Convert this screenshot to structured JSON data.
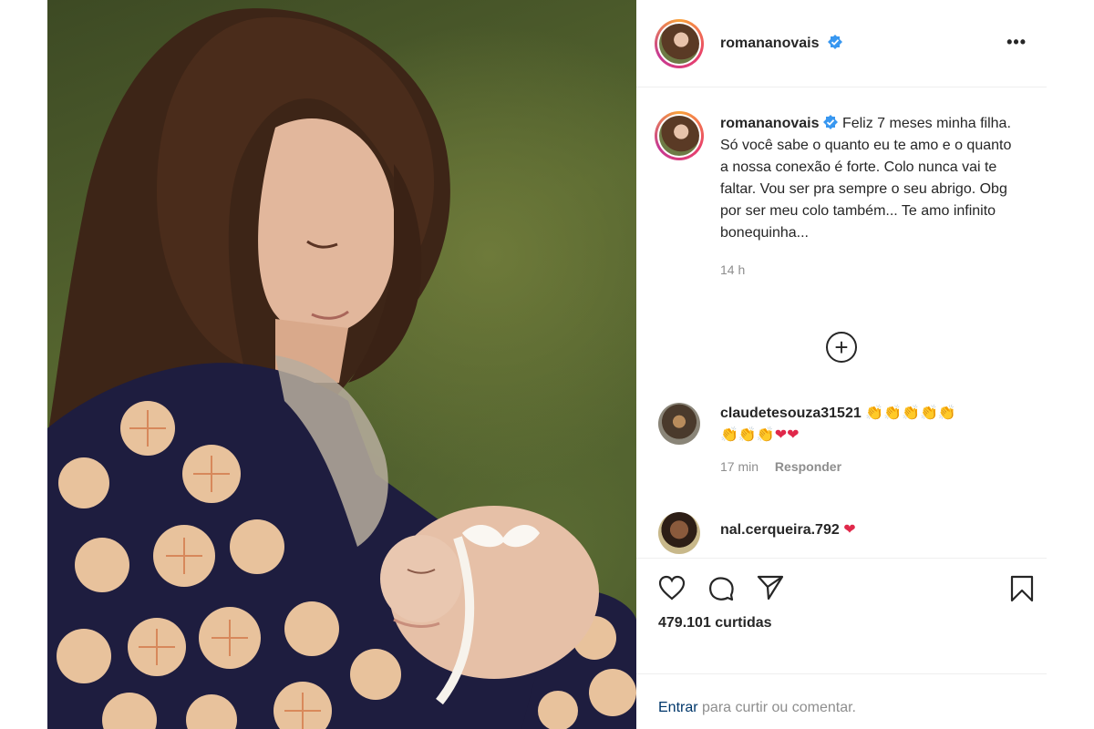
{
  "post": {
    "username": "romananovais",
    "more_icon": "more-dots-icon",
    "verified_icon": "verified-badge-icon"
  },
  "caption": {
    "username": "romananovais",
    "text": "Feliz 7 meses minha filha. Só você sabe o quanto eu te amo e o quanto a nossa conexão é forte. Colo nunca vai te faltar. Vou ser pra sempre o seu abrigo. Obg por ser meu colo também... Te amo infinito bonequinha...",
    "time": "14 h"
  },
  "load_more_label": "+",
  "comments": [
    {
      "username": "claudetesouza31521",
      "text_emoji": "👏👏👏👏👏",
      "text_emoji2": "👏👏👏",
      "hearts": "❤❤",
      "time": "17 min",
      "reply_label": "Responder"
    },
    {
      "username": "nal.cerqueira.792",
      "hearts": "❤"
    }
  ],
  "actions": {
    "like_icon": "heart-icon",
    "comment_icon": "comment-icon",
    "share_icon": "share-icon",
    "save_icon": "bookmark-icon",
    "likes_count": "479.101 curtidas"
  },
  "login": {
    "enter_label": "Entrar",
    "rest_label": " para curtir ou comentar."
  },
  "colors": {
    "accent_link": "#00376b",
    "verified": "#3897f0",
    "heart": "#e0284a"
  }
}
